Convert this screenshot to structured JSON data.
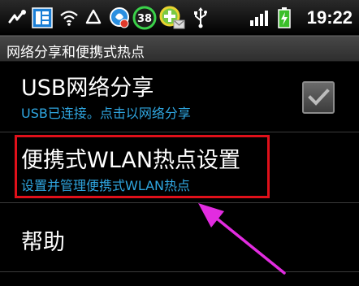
{
  "status_bar": {
    "time": "19:22",
    "battery_badge": "38",
    "icons": [
      "usb-debug-icon",
      "menu-grid-icon",
      "wifi-icon",
      "recycle-icon",
      "shield-app-icon",
      "battery-badge-icon",
      "download-app-icon",
      "usb-icon",
      "signal-icon",
      "battery-icon"
    ]
  },
  "title_bar": {
    "title": "网络分享和便携式热点"
  },
  "list": {
    "items": [
      {
        "title": "USB网络分享",
        "subtitle": "USB已连接。点击以网络分享",
        "checked": true
      },
      {
        "title": "便携式WLAN热点设置",
        "subtitle": "设置并管理便携式WLAN热点"
      },
      {
        "title": "帮助"
      }
    ]
  },
  "colors": {
    "subtitle": "#2fa6e0",
    "highlight": "#e0101a",
    "arrow": "#e22ce0"
  }
}
